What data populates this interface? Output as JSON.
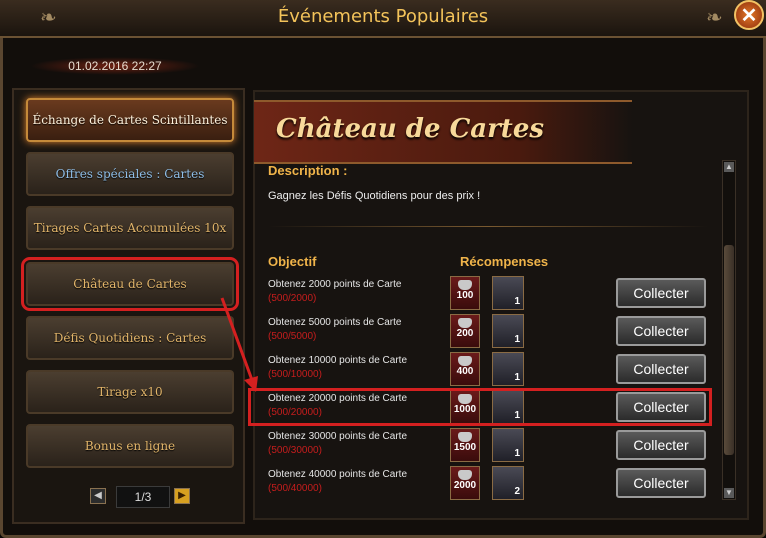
{
  "window": {
    "title": "Événements Populaires",
    "close_label": "✕"
  },
  "datetime": "01.02.2016 22:27",
  "menu": [
    {
      "label": "Échange de Cartes Scintillantes"
    },
    {
      "label": "Offres spéciales : Cartes"
    },
    {
      "label": "Tirages Cartes Accumulées 10x"
    },
    {
      "label": "Château de Cartes"
    },
    {
      "label": "Défis Quotidiens : Cartes"
    },
    {
      "label": "Tirage x10"
    },
    {
      "label": "Bonus en ligne"
    }
  ],
  "pager": {
    "text": "1/3",
    "prev": "◀",
    "next": "▶"
  },
  "event": {
    "title": "Château de Cartes",
    "description_label": "Description :",
    "description": "Gagnez les Défis Quotidiens pour des prix !",
    "objective_label": "Objectif",
    "rewards_label": "Récompenses"
  },
  "objectives": [
    {
      "line1": "Obtenez 2000 points de Carte",
      "line2": "",
      "progress": "(500/2000)",
      "gems": "100",
      "card_count": "1",
      "button": "Collecter"
    },
    {
      "line1": "Obtenez 5000 points de Carte",
      "line2": "",
      "progress": "(500/5000)",
      "gems": "200",
      "card_count": "1",
      "button": "Collecter"
    },
    {
      "line1": "Obtenez 10000 points de",
      "line2": "Carte",
      "progress": "(500/10000)",
      "gems": "400",
      "card_count": "1",
      "button": "Collecter"
    },
    {
      "line1": "Obtenez 20000 points de",
      "line2": "Carte",
      "progress": "(500/20000)",
      "gems": "1000",
      "card_count": "1",
      "button": "Collecter"
    },
    {
      "line1": "Obtenez 30000 points de",
      "line2": "Carte",
      "progress": "(500/30000)",
      "gems": "1500",
      "card_count": "1",
      "button": "Collecter"
    },
    {
      "line1": "Obtenez 40000 points de",
      "line2": "Carte",
      "progress": "(500/40000)",
      "gems": "2000",
      "card_count": "2",
      "button": "Collecter"
    }
  ]
}
